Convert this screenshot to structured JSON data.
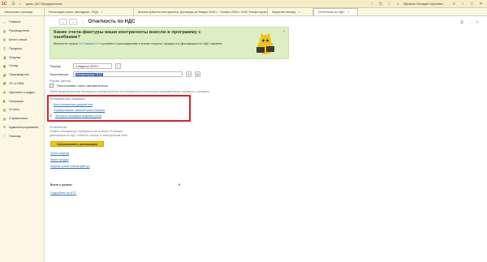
{
  "titlebar": {
    "app_title": "демо (1С:Предприятие)",
    "user_name": "Абрамов Геннадий Сергеевич",
    "icons": [
      "menu-icon",
      "home-icon",
      "bell-icon",
      "history-icon",
      "star-icon",
      "search-icon"
    ]
  },
  "tabs": [
    {
      "label": "Начальная страница"
    },
    {
      "label": "Реализация (акты, накладные, УПД)"
    },
    {
      "label": "Анализ субконто Контрагенты, Договоры за Январь 2025 г. - Ноябрь 2025 г. ООО \"Конфетпром\""
    },
    {
      "label": "Закрытие месяца"
    },
    {
      "label": "Отчетность по НДС"
    }
  ],
  "sidebar": {
    "items": [
      {
        "label": "Главное",
        "icon": "home-icon"
      },
      {
        "label": "Руководителю",
        "icon": "chart-icon"
      },
      {
        "label": "Банк и касса",
        "icon": "bank-icon"
      },
      {
        "label": "Продажи",
        "icon": "cart-icon"
      },
      {
        "label": "Покупки",
        "icon": "basket-icon"
      },
      {
        "label": "Склад",
        "icon": "box-icon"
      },
      {
        "label": "Производство",
        "icon": "factory-icon"
      },
      {
        "label": "ОС и НМА",
        "icon": "building-icon"
      },
      {
        "label": "Зарплата и кадры",
        "icon": "people-icon"
      },
      {
        "label": "Операции",
        "icon": "operations-icon"
      },
      {
        "label": "Отчеты",
        "icon": "report-icon"
      },
      {
        "label": "Справочники",
        "icon": "book-icon"
      },
      {
        "label": "Администрирование",
        "icon": "gear-icon"
      },
      {
        "label": "Помощь",
        "icon": "help-icon"
      }
    ]
  },
  "page": {
    "title": "Отчетность по НДС",
    "nav_back": "←",
    "nav_forward": "→"
  },
  "banner": {
    "title": "Какие счета-фактуры ваши контрагенты внесли в программу с ошибками?",
    "text_before": "Включите сервис ",
    "link": "1С:Сверка 2.0",
    "text_after": " и узнайте о расхождениях в книгах покупок, продаж и в Декларации по НДС заранее"
  },
  "form": {
    "period_label": "Период:",
    "period_value": "4 квартал 2025 г.",
    "org_label": "Организация:",
    "org_value": "Конфетпром ООО",
    "section_calc": "Расчет налога",
    "auto_calc_label": "Рассчитывать налог автоматически",
    "hint": "Перед формированием декларации рекомендуется последовательно выполнить регламентные операции и проверки",
    "section_ops": "Регламентные операции",
    "op_links": [
      "Восстановление документов",
      "Формирование записей книги покупок",
      "Экспресс-проверка ведения учета"
    ],
    "section_report": "Отчетность",
    "report_text_1": "Подать декларацию требуется не позднее 25 января.",
    "report_text_2": "Декларация по НДС сдается только в электронном виде.",
    "generate_button": "Сформировать декларацию",
    "bottom_links": [
      "Книга покупок",
      "Книга продаж",
      "Журнал учета счетов-фактур"
    ],
    "total_label": "Всего к уплате:",
    "total_value": "0",
    "submit_link": "Подробнее на ИТС"
  }
}
